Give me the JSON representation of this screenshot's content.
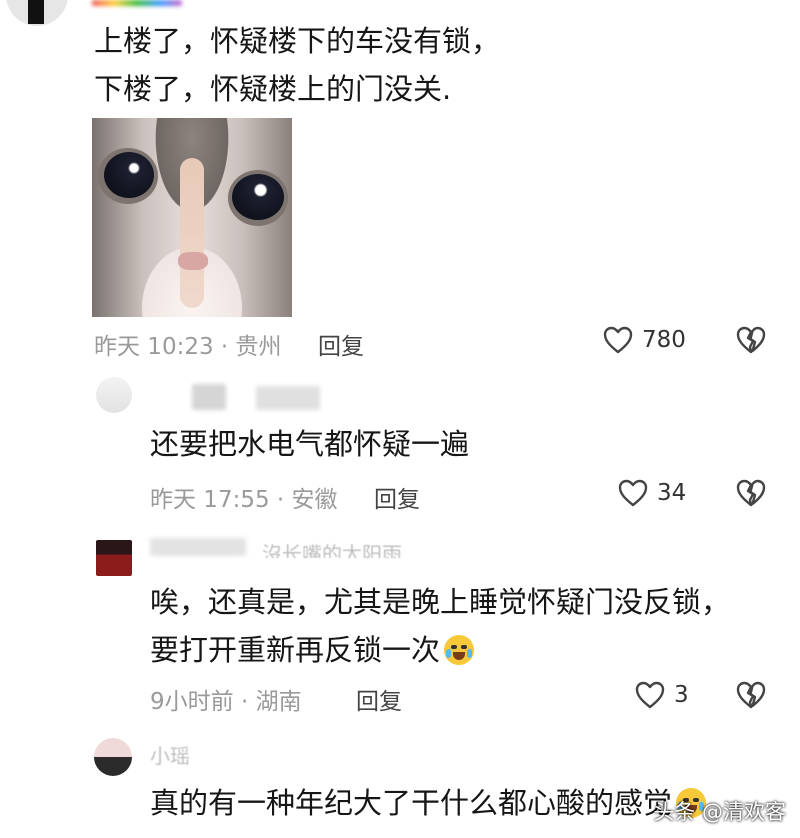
{
  "comments": [
    {
      "lines": [
        "上楼了，怀疑楼下的车没有锁，",
        "下楼了，怀疑楼上的门没关."
      ],
      "time_location": "昨天 10:23 · 贵州",
      "reply_label": "回复",
      "likes": "780"
    },
    {
      "lines": [
        "还要把水电气都怀疑一遍"
      ],
      "time_location": "昨天 17:55 · 安徽",
      "reply_label": "回复",
      "likes": "34"
    },
    {
      "username_partial": "沒长嘴的太阳雨",
      "lines": [
        "唉，还真是，尤其是晚上睡觉怀疑门没反锁，",
        "要打开重新再反锁一次"
      ],
      "time_location": "9小时前 · 湖南",
      "reply_label": "回复",
      "likes": "3"
    },
    {
      "username_partial": "小瑶",
      "lines": [
        "真的有一种年纪大了干什么都心酸的感觉"
      ]
    }
  ],
  "watermark": "头条 @清欢客",
  "icons": {
    "like": "heart-outline-icon",
    "dislike": "broken-heart-icon",
    "emoji": "crying-laughing-emoji"
  },
  "colors": {
    "text": "#161616",
    "meta": "#9a9a9a",
    "reply": "#444444"
  }
}
